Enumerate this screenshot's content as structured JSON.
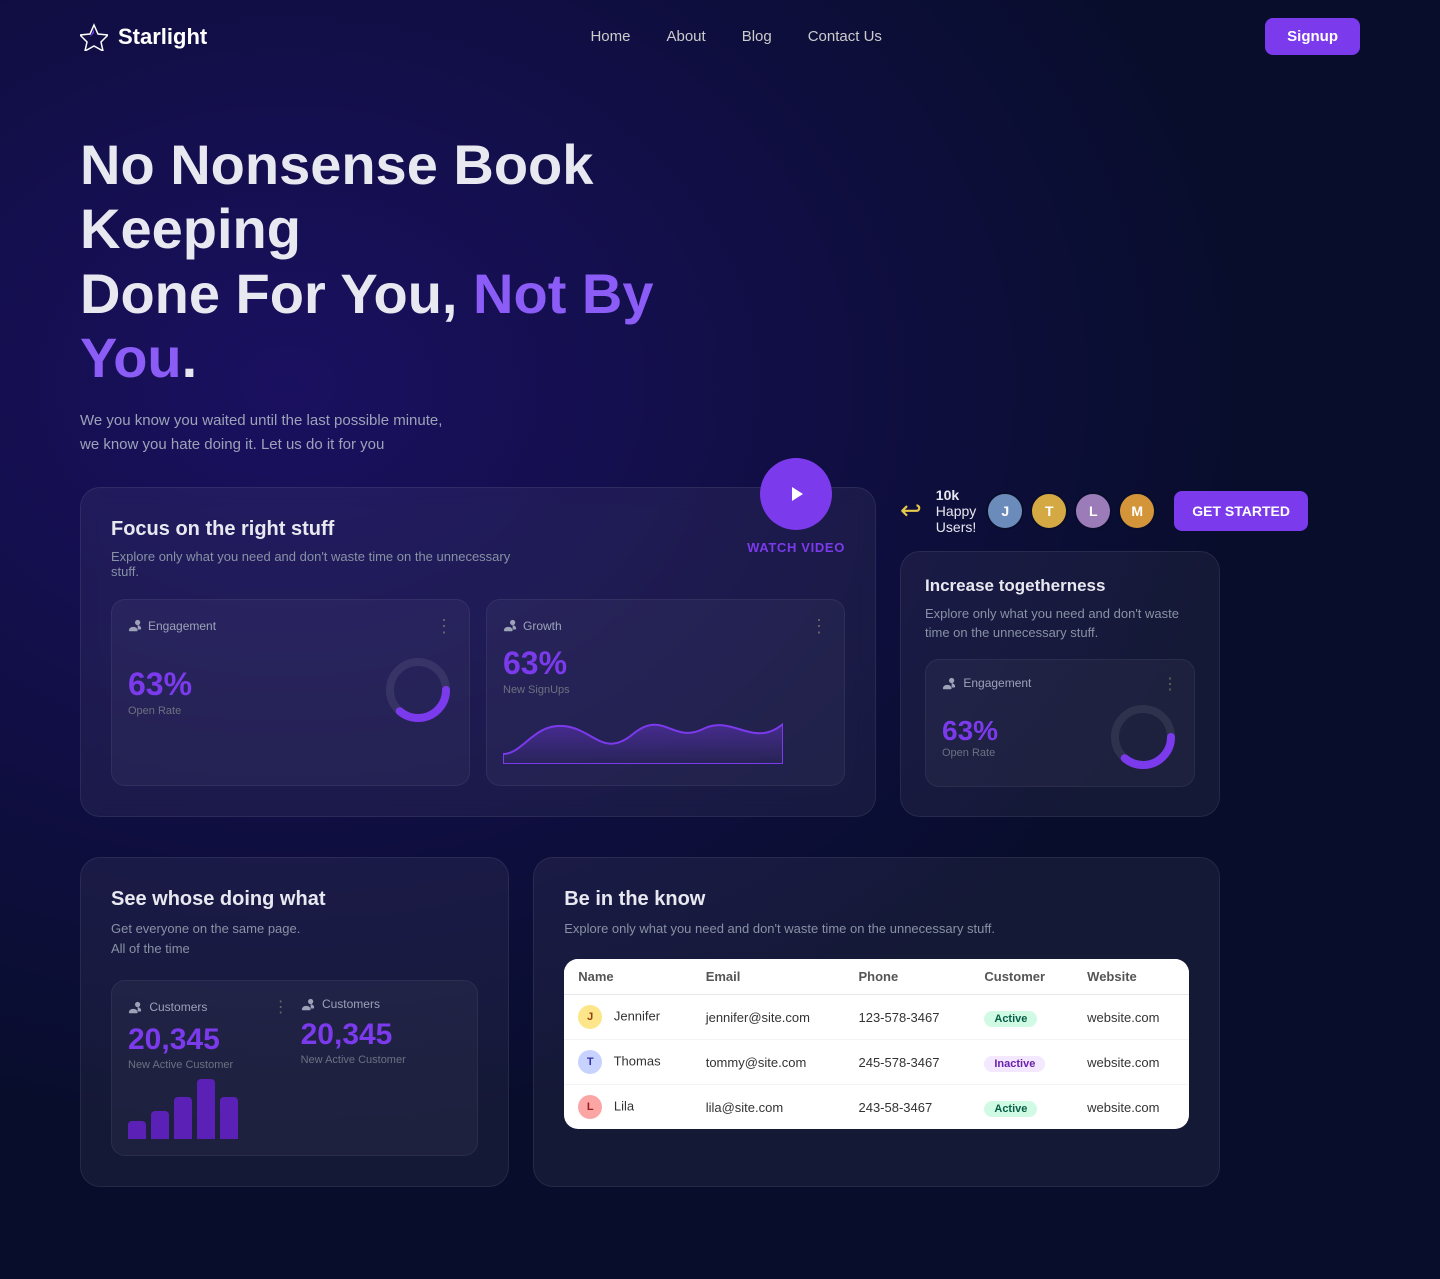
{
  "meta": {
    "title": "Starlight - No Nonsense Book Keeping"
  },
  "nav": {
    "logo_text": "Starlight",
    "links": [
      "Home",
      "About",
      "Blog",
      "Contact Us"
    ],
    "signup_label": "Signup"
  },
  "hero": {
    "title_line1": "No Nonsense Book Keeping",
    "title_line2_plain": "Done For You,",
    "title_line2_highlight": "Not By You",
    "title_period": ".",
    "subtitle": "We you know you waited until the last possible minute, we know you hate doing it. Let us do it for you"
  },
  "focus_card": {
    "title": "Focus on the right stuff",
    "description": "Explore only what you need and don't waste time on the unnecessary stuff.",
    "watch_label": "WATCH",
    "video_label": "VIDEO"
  },
  "engagement_card": {
    "icon": "users",
    "title": "Engagement",
    "percent": "63%",
    "sub_label": "Open Rate"
  },
  "growth_card": {
    "icon": "users",
    "title": "Growth",
    "percent": "63%",
    "sub_label": "New SignUps"
  },
  "happy_users": {
    "count": "10k",
    "label": "Happy Users!"
  },
  "get_started_label": "GET STARTED",
  "togetherness_card": {
    "title": "Increase togetherness",
    "description": "Explore only what you need and don't waste time on the unnecessary stuff.",
    "mini_title": "Engagement",
    "mini_percent": "63%",
    "mini_sub_label": "Open Rate"
  },
  "see_card": {
    "title": "See whose doing what",
    "description_line1": "Get everyone on the same page.",
    "description_line2": "All of the time",
    "customers_label": "Customers",
    "customers_number": "20,345",
    "customers_sub": "New Active Customer"
  },
  "know_card": {
    "title": "Be in the know",
    "description": "Explore only what you need and don't waste time on the unnecessary stuff.",
    "table": {
      "headers": [
        "Name",
        "Email",
        "Phone",
        "Customer",
        "Website"
      ],
      "rows": [
        {
          "name": "Jennifer",
          "email": "jennifer@site.com",
          "phone": "123-578-3467",
          "status": "Active",
          "status_type": "active",
          "website": "website.com"
        },
        {
          "name": "Thomas",
          "email": "tommy@site.com",
          "phone": "245-578-3467",
          "status": "Inactive",
          "status_type": "inactive",
          "website": "website.com"
        },
        {
          "name": "Lila",
          "email": "lila@site.com",
          "phone": "243-58-3467",
          "status": "Active",
          "status_type": "active",
          "website": "website.com"
        }
      ]
    }
  },
  "colors": {
    "accent": "#7c3aed",
    "bg_dark": "#080d2b",
    "text_muted": "#8892a4"
  }
}
